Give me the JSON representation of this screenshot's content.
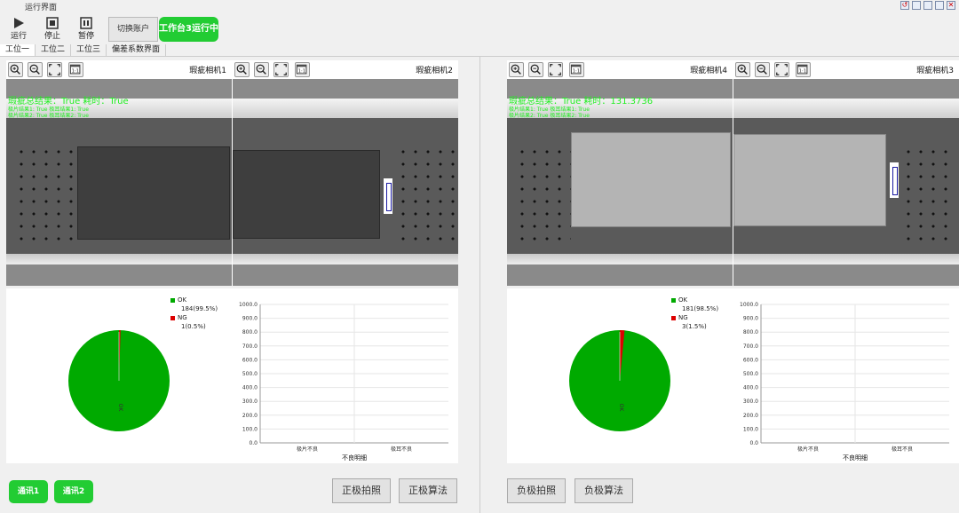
{
  "window": {
    "title": "运行界面"
  },
  "toolbar": {
    "run_label": "运行",
    "stop_label": "停止",
    "pause_label": "暂停",
    "switch_user_label": "切换账户",
    "status_label": "工作台3运行中"
  },
  "tabs": [
    {
      "label": "工位一"
    },
    {
      "label": "工位二"
    },
    {
      "label": "工位三"
    },
    {
      "label": "偏差系数界面"
    }
  ],
  "cameras": [
    {
      "name": "瑕疵相机1",
      "overlay_line1": "瑕疵总结果：True 耗时：True",
      "overlay_line2": "极片结果1: True  极耳结果1: True",
      "overlay_line3": "极片结果2: True  极耳结果2: True"
    },
    {
      "name": "瑕疵相机2"
    },
    {
      "name": "瑕疵相机4",
      "overlay_line1": "瑕疵总结果：True 耗时：131.3736",
      "overlay_line2": "极片结果1: True  极耳结果1: True",
      "overlay_line3": "极片结果2: True  极耳结果2: True"
    },
    {
      "name": "瑕疵相机3"
    }
  ],
  "stats_left": {
    "ok_label": "OK",
    "ok_value": "184(99.5%)",
    "ng_label": "NG",
    "ng_value": "1(0.5%)",
    "ok_fraction": 0.995,
    "pie_center_label": "OK"
  },
  "stats_right": {
    "ok_label": "OK",
    "ok_value": "181(98.5%)",
    "ng_label": "NG",
    "ng_value": "3(1.5%)",
    "ok_fraction": 0.985,
    "pie_center_label": "OK"
  },
  "colors": {
    "ok": "#00aa00",
    "ng": "#dd0000",
    "accent": "#22cc33"
  },
  "chart_data": [
    {
      "type": "bar",
      "categories": [
        "极片不良",
        "极耳不良"
      ],
      "values": [
        0,
        0
      ],
      "xlabel": "不良明细",
      "ylim": [
        0,
        1000
      ],
      "yticks": [
        "0.0",
        "100.0",
        "200.0",
        "300.0",
        "400.0",
        "500.0",
        "600.0",
        "700.0",
        "800.0",
        "900.0",
        "1000.0"
      ]
    },
    {
      "type": "bar",
      "categories": [
        "极片不良",
        "极耳不良"
      ],
      "values": [
        0,
        0
      ],
      "xlabel": "不良明细",
      "ylim": [
        0,
        1000
      ],
      "yticks": [
        "0.0",
        "100.0",
        "200.0",
        "300.0",
        "400.0",
        "500.0",
        "600.0",
        "700.0",
        "800.0",
        "900.0",
        "1000.0"
      ]
    }
  ],
  "buttons": {
    "comm1_label": "通讯1",
    "comm2_label": "通讯2",
    "pos_photo_label": "正极拍照",
    "pos_algo_label": "正极算法",
    "neg_photo_label": "负极拍照",
    "neg_algo_label": "负极算法"
  }
}
